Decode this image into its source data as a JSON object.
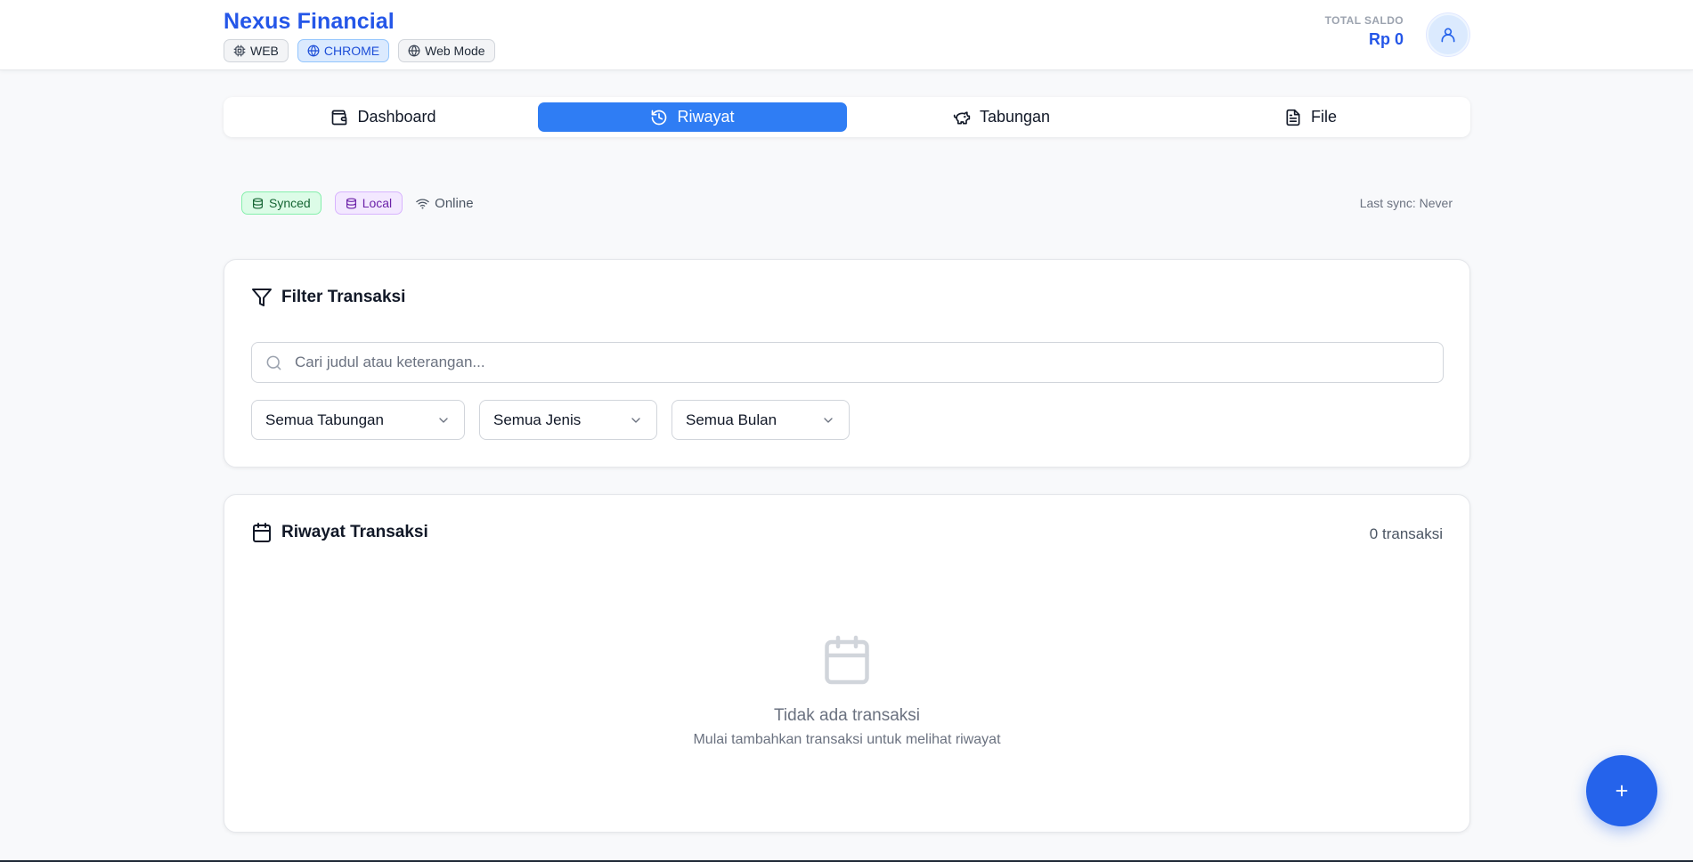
{
  "header": {
    "brand": "Nexus Financial",
    "platform_badges": [
      {
        "label": "WEB",
        "icon": "cpu-icon"
      },
      {
        "label": "CHROME",
        "icon": "globe-icon"
      },
      {
        "label": "Web Mode",
        "icon": "globe-icon"
      }
    ],
    "saldo_label": "TOTAL SALDO",
    "saldo_value": "Rp 0",
    "avatar_icon": "user-icon"
  },
  "tabs": [
    {
      "label": "Dashboard",
      "icon": "wallet-icon",
      "active": false
    },
    {
      "label": "Riwayat",
      "icon": "history-icon",
      "active": true
    },
    {
      "label": "Tabungan",
      "icon": "piggy-bank-icon",
      "active": false
    },
    {
      "label": "File",
      "icon": "file-text-icon",
      "active": false
    }
  ],
  "status": {
    "synced": "Synced",
    "local": "Local",
    "online": "Online",
    "last_sync": "Last sync: Never"
  },
  "filter": {
    "title": "Filter Transaksi",
    "search_placeholder": "Cari judul atau keterangan...",
    "search_value": "",
    "selects": [
      "Semua Tabungan",
      "Semua Jenis",
      "Semua Bulan"
    ]
  },
  "history": {
    "title": "Riwayat Transaksi",
    "count": "0 transaksi",
    "empty_title": "Tidak ada transaksi",
    "empty_subtitle": "Mulai tambahkan transaksi untuk melihat riwayat"
  },
  "fab": {
    "icon": "plus-icon"
  },
  "colors": {
    "brand": "#2456e8",
    "tab_active": "#2f7df4",
    "fab": "#2563eb",
    "synced_bg": "#dcfce7",
    "local_bg": "#f3e8ff"
  }
}
